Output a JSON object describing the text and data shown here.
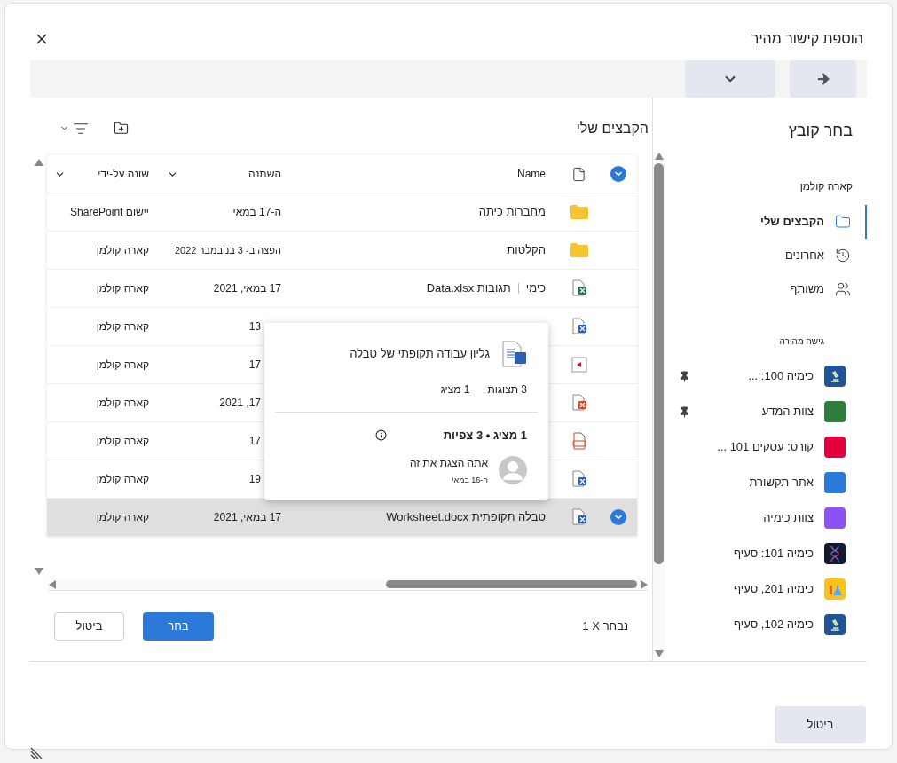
{
  "dialog": {
    "title": "הוספת קישור מהיר"
  },
  "sidebar": {
    "title": "בחר קובץ",
    "user": "קארה קולמן",
    "nav": [
      {
        "label": "הקבצים שלי",
        "kind": "folder",
        "selected": true
      },
      {
        "label": "אחרונים",
        "kind": "recent",
        "selected": false
      },
      {
        "label": "משותף",
        "kind": "shared",
        "selected": false
      }
    ],
    "quick_access_heading": "גישה מהירה",
    "quick_access": [
      {
        "label": "כימיה 100: ...",
        "kind": "microscope",
        "color": "#1f5596",
        "pinned": true
      },
      {
        "label": "צוות המדע",
        "kind": "tile",
        "color": "#2e7d3c",
        "pinned": true
      },
      {
        "label": "קורס: עסקים 101 ...",
        "kind": "tile",
        "color": "#e3003c",
        "pinned": false
      },
      {
        "label": "אתר תקשורת",
        "kind": "tile",
        "color": "#2b79d8",
        "pinned": false
      },
      {
        "label": "צוות כימיה",
        "kind": "tile",
        "color": "#8c52f5",
        "pinned": false
      },
      {
        "label": "כימיה 101: סעיף",
        "kind": "dna",
        "color": "#141a2e",
        "pinned": false
      },
      {
        "label": "כימיה 201, סעיף",
        "kind": "flask",
        "color": "#fbc21a",
        "pinned": false
      },
      {
        "label": "כימיה 102, סעיף",
        "kind": "microscope",
        "color": "#1f5596",
        "pinned": false
      }
    ]
  },
  "files": {
    "title": "הקבצים שלי",
    "columns": [
      "Name",
      "השתנה",
      "שונה על-ידי"
    ],
    "rows": [
      {
        "kind": "folder",
        "name": "מחברות כיתה",
        "modified": "ה-17 במאי",
        "modified_by": "יישום SharePoint",
        "selected": false
      },
      {
        "kind": "folder",
        "name": "הקלטות",
        "modified": "הפצה ב- 3 בנובמבר 2022",
        "modified_by": "קארה קולמן",
        "selected": false
      },
      {
        "kind": "excel",
        "name": "כימי",
        "name_2": "תגובות Data.xlsx",
        "modified": "17 במאי, 2021",
        "modified_by": "קארה קולמן",
        "selected": false
      },
      {
        "kind": "word",
        "modified": "13",
        "modified_by": "קארה קולמן",
        "selected": false
      },
      {
        "kind": "video",
        "modified": "17",
        "modified_by": "קארה קולמן",
        "selected": false
      },
      {
        "kind": "ppt",
        "modified": "17, 2021",
        "modified_by": "קארה קולמן",
        "selected": false
      },
      {
        "kind": "form",
        "modified": "17",
        "modified_by": "קארה קולמן",
        "selected": false
      },
      {
        "kind": "word",
        "modified": "19",
        "modified_by": "קארה קולמן",
        "selected": false
      },
      {
        "kind": "word",
        "name": "טבלה תקופתית Worksheet.docx",
        "modified": "17 במאי, 2021",
        "modified_by": "קארה קולמן",
        "selected": true
      }
    ],
    "popup": {
      "title": "גליון עבודה תקופתי של טבלה",
      "views": "3 תצוגות",
      "viewers": "1 מציג",
      "summary": "1 מציג • 3 צפיות",
      "activity": "אתה הצגת את זה",
      "activity_date": "ה-16 במאי"
    },
    "selection_count": "1 X נבחר",
    "buttons": [
      "בחר",
      "ביטול"
    ]
  },
  "footer": {
    "buttons": [
      "ביטול"
    ]
  }
}
